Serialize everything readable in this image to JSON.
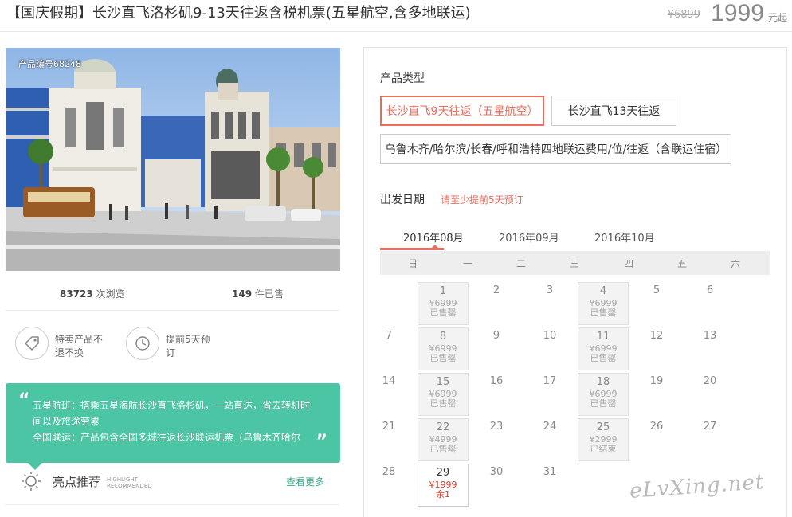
{
  "header": {
    "title": "【国庆假期】长沙直飞洛杉矶9-13天往返含税机票(五星航空,含多地联运)",
    "old_price": "¥6899",
    "price": "1999",
    "unit": "元起"
  },
  "gallery": {
    "product_no": "产品编号68248"
  },
  "stats": {
    "views_num": "83723",
    "views_label": "次浏览",
    "sold_num": "149",
    "sold_label": "件已售"
  },
  "features": [
    {
      "icon": "tag-icon",
      "text": "特卖产品不退不换"
    },
    {
      "icon": "clock-icon",
      "text": "提前5天预订"
    }
  ],
  "highlight": {
    "line1": "五星航班：搭乘五星海航长沙直飞洛杉矶，一站直达，省去转机时间以及旅途劳累",
    "line2": "全国联运：产品包含全国多城往返长沙联运机票（乌鲁木齐哈尔",
    "title": "亮点推荐",
    "title_en_1": "HIGHLIGHT",
    "title_en_2": "RECOMMENDED",
    "see_more": "查看更多"
  },
  "product_type": {
    "label": "产品类型",
    "options": [
      "长沙直飞9天往返（五星航空）",
      "长沙直飞13天往返",
      "乌鲁木齐/哈尔滨/长春/呼和浩特四地联运费用/位/往返（含联运住宿）"
    ],
    "selected": 0
  },
  "departure": {
    "label": "出发日期",
    "note": "请至少提前5天预订",
    "months": [
      "2016年08月",
      "2016年09月",
      "2016年10月"
    ],
    "active_month": 0,
    "weekdays": [
      "日",
      "一",
      "二",
      "三",
      "四",
      "五",
      "六"
    ],
    "days": [
      {
        "d": "1",
        "price": "¥6999",
        "status": "已售罄",
        "state": "sold"
      },
      {
        "d": "2"
      },
      {
        "d": "3"
      },
      {
        "d": "4",
        "price": "¥6999",
        "status": "已售罄",
        "state": "sold"
      },
      {
        "d": "5"
      },
      {
        "d": "6"
      },
      {
        "d": "7"
      },
      {
        "d": "8",
        "price": "¥6999",
        "status": "已售罄",
        "state": "sold"
      },
      {
        "d": "9"
      },
      {
        "d": "10"
      },
      {
        "d": "11",
        "price": "¥6999",
        "status": "已售罄",
        "state": "sold"
      },
      {
        "d": "12"
      },
      {
        "d": "13"
      },
      {
        "d": "14"
      },
      {
        "d": "15",
        "price": "¥6999",
        "status": "已售罄",
        "state": "sold"
      },
      {
        "d": "16"
      },
      {
        "d": "17"
      },
      {
        "d": "18",
        "price": "¥6999",
        "status": "已售罄",
        "state": "sold"
      },
      {
        "d": "19"
      },
      {
        "d": "20"
      },
      {
        "d": "21"
      },
      {
        "d": "22",
        "price": "¥4999",
        "status": "已售罄",
        "state": "sold"
      },
      {
        "d": "23"
      },
      {
        "d": "24"
      },
      {
        "d": "25",
        "price": "¥2999",
        "status": "已结束",
        "state": "sold"
      },
      {
        "d": "26"
      },
      {
        "d": "27"
      },
      {
        "d": "28"
      },
      {
        "d": "29",
        "price": "¥1999",
        "status": "余1",
        "state": "avail"
      },
      {
        "d": "30"
      },
      {
        "d": "31"
      }
    ],
    "first_weekday": 1
  },
  "watermark": "eLvXing.net",
  "colors": {
    "accent": "#e96e5e",
    "teal": "#4cc5a4",
    "price_red": "#e03a2a"
  }
}
